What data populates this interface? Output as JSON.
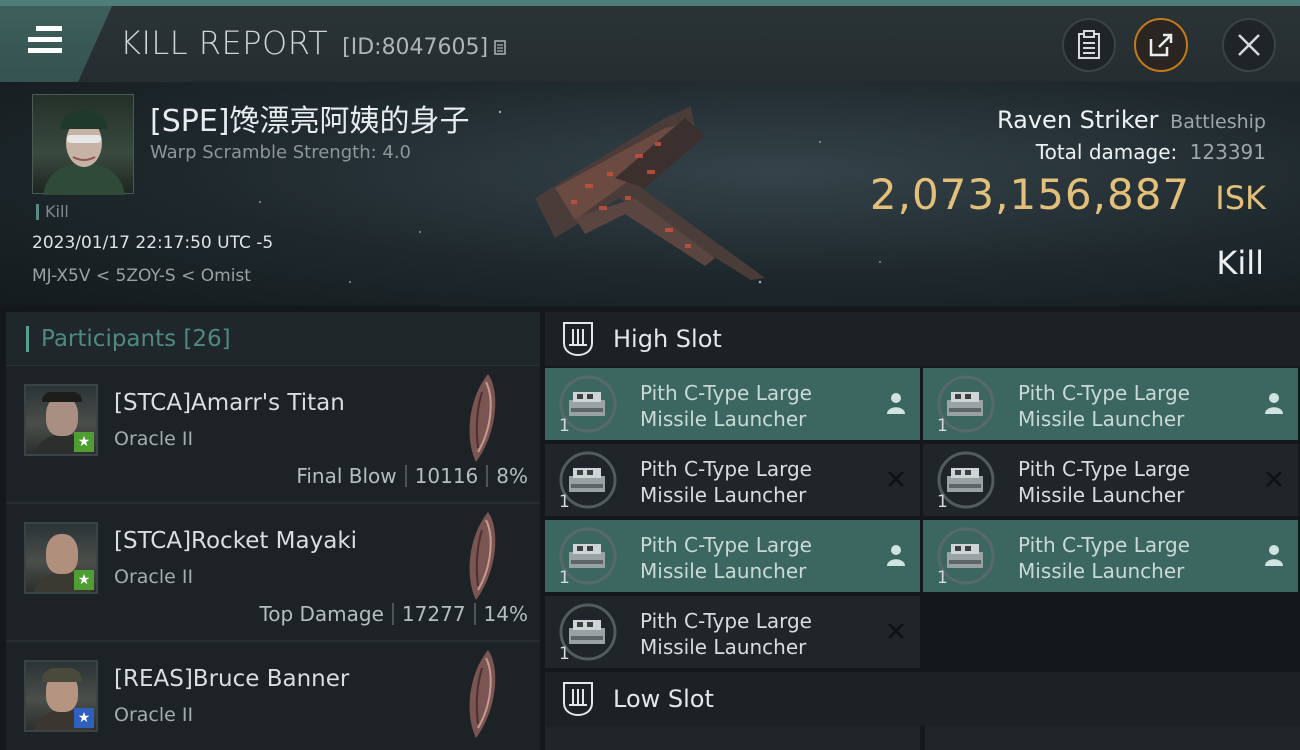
{
  "header": {
    "title": "KILL REPORT",
    "id_label": "[ID:8047605]"
  },
  "victim": {
    "name": "[SPE]馋漂亮阿姨的身子",
    "warp_scramble": "Warp Scramble Strength: 4.0",
    "tag": "Kill",
    "datetime": "2023/01/17 22:17:50 UTC -5",
    "location": "MJ-X5V < 5ZOY-S < Omist",
    "ship_name": "Raven Striker",
    "ship_class": "Battleship",
    "total_damage_label": "Total damage:",
    "total_damage": "123391",
    "isk_value": "2,073,156,887",
    "isk_unit": "ISK",
    "kill_type": "Kill"
  },
  "participants": {
    "label": "Participants",
    "count": "[26]",
    "rows": [
      {
        "name": "[STCA]Amarr's Titan",
        "ship": "Oracle II",
        "role": "Final Blow",
        "damage": "10116",
        "percent": "8%",
        "badge": "green"
      },
      {
        "name": "[STCA]Rocket Mayaki",
        "ship": "Oracle II",
        "role": "Top Damage",
        "damage": "17277",
        "percent": "14%",
        "badge": "green"
      },
      {
        "name": "[REAS]Bruce Banner",
        "ship": "Oracle II",
        "role": "",
        "damage": "",
        "percent": "",
        "badge": "blue"
      }
    ]
  },
  "high_slot": {
    "label": "High Slot",
    "items": [
      {
        "name_line1": "Pith C-Type Large",
        "name_line2": "Missile Launcher",
        "qty": "1",
        "state": "dropped"
      },
      {
        "name_line1": "Pith C-Type Large",
        "name_line2": "Missile Launcher",
        "qty": "1",
        "state": "dropped"
      },
      {
        "name_line1": "Pith C-Type Large",
        "name_line2": "Missile Launcher",
        "qty": "1",
        "state": "destroyed"
      },
      {
        "name_line1": "Pith C-Type Large",
        "name_line2": "Missile Launcher",
        "qty": "1",
        "state": "destroyed"
      },
      {
        "name_line1": "Pith C-Type Large",
        "name_line2": "Missile Launcher",
        "qty": "1",
        "state": "dropped"
      },
      {
        "name_line1": "Pith C-Type Large",
        "name_line2": "Missile Launcher",
        "qty": "1",
        "state": "dropped"
      },
      {
        "name_line1": "Pith C-Type Large",
        "name_line2": "Missile Launcher",
        "qty": "1",
        "state": "destroyed"
      }
    ]
  },
  "low_slot": {
    "label": "Low Slot"
  },
  "colors": {
    "accent_teal": "#3c6660",
    "isk_gold": "#e3c07a",
    "header_stripe": "#4f7d78"
  }
}
